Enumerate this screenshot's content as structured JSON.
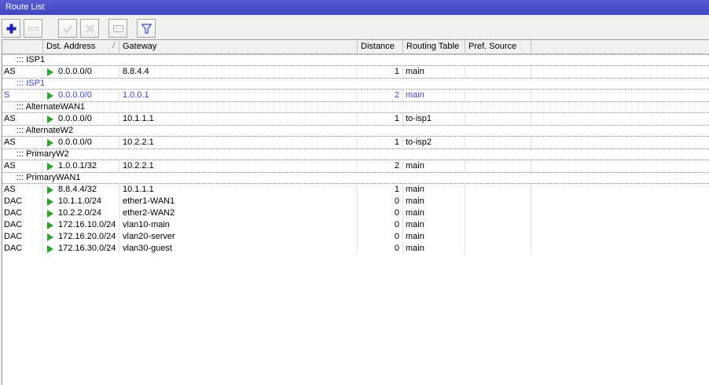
{
  "window": {
    "title": "Route List"
  },
  "colors": {
    "titlebar_blue": "#4a50c8",
    "inactive_route_blue": "#4242cd",
    "route_arrow_green": "#2ba52b",
    "add_button_blue": "#2121ad",
    "disabled_icon_gray": "#c4c4c4",
    "filter_icon_blue": "#4553c0"
  },
  "toolbar": {
    "buttons": [
      {
        "name": "add",
        "icon": "plus-icon",
        "enabled": true
      },
      {
        "name": "remove",
        "icon": "minus-icon",
        "enabled": false
      },
      {
        "name": "enable",
        "icon": "check-icon",
        "enabled": false
      },
      {
        "name": "disable",
        "icon": "cross-icon",
        "enabled": false
      },
      {
        "name": "comment",
        "icon": "comment-icon",
        "enabled": false
      },
      {
        "name": "filter",
        "icon": "filter-icon",
        "enabled": true
      }
    ]
  },
  "table": {
    "columns": [
      "",
      "Dst. Address",
      "Gateway",
      "Distance",
      "Routing Table",
      "Pref. Source"
    ],
    "sort_column": "Dst. Address",
    "sort_indicator": "/",
    "rows": [
      {
        "type": "comment",
        "text": "::: ISP1"
      },
      {
        "type": "route",
        "flags": "AS",
        "dst": "0.0.0.0/0",
        "gateway": "8.8.4.4",
        "distance": "1",
        "table": "main",
        "pref": ""
      },
      {
        "type": "comment",
        "text": "::: ISP1",
        "inactive": true
      },
      {
        "type": "route",
        "flags": "S",
        "dst": "0.0.0.0/0",
        "gateway": "1.0.0.1",
        "distance": "2",
        "table": "main",
        "pref": "",
        "inactive": true
      },
      {
        "type": "comment",
        "text": "::: AlternateWAN1"
      },
      {
        "type": "route",
        "flags": "AS",
        "dst": "0.0.0.0/0",
        "gateway": "10.1.1.1",
        "distance": "1",
        "table": "to-isp1",
        "pref": ""
      },
      {
        "type": "comment",
        "text": "::: AlternateW2"
      },
      {
        "type": "route",
        "flags": "AS",
        "dst": "0.0.0.0/0",
        "gateway": "10.2.2.1",
        "distance": "1",
        "table": "to-isp2",
        "pref": ""
      },
      {
        "type": "comment",
        "text": "::: PrimaryW2"
      },
      {
        "type": "route",
        "flags": "AS",
        "dst": "1.0.0.1/32",
        "gateway": "10.2.2.1",
        "distance": "2",
        "table": "main",
        "pref": ""
      },
      {
        "type": "comment",
        "text": "::: PrimaryWAN1"
      },
      {
        "type": "route",
        "flags": "AS",
        "dst": "8.8.4.4/32",
        "gateway": "10.1.1.1",
        "distance": "1",
        "table": "main",
        "pref": ""
      },
      {
        "type": "route",
        "flags": "DAC",
        "dst": "10.1.1.0/24",
        "gateway": "ether1-WAN1",
        "distance": "0",
        "table": "main",
        "pref": ""
      },
      {
        "type": "route",
        "flags": "DAC",
        "dst": "10.2.2.0/24",
        "gateway": "ether2-WAN2",
        "distance": "0",
        "table": "main",
        "pref": ""
      },
      {
        "type": "route",
        "flags": "DAC",
        "dst": "172.16.10.0/24",
        "gateway": "vlan10-main",
        "distance": "0",
        "table": "main",
        "pref": ""
      },
      {
        "type": "route",
        "flags": "DAC",
        "dst": "172.16.20.0/24",
        "gateway": "vlan20-server",
        "distance": "0",
        "table": "main",
        "pref": ""
      },
      {
        "type": "route",
        "flags": "DAC",
        "dst": "172.16.30.0/24",
        "gateway": "vlan30-guest",
        "distance": "0",
        "table": "main",
        "pref": ""
      }
    ]
  }
}
